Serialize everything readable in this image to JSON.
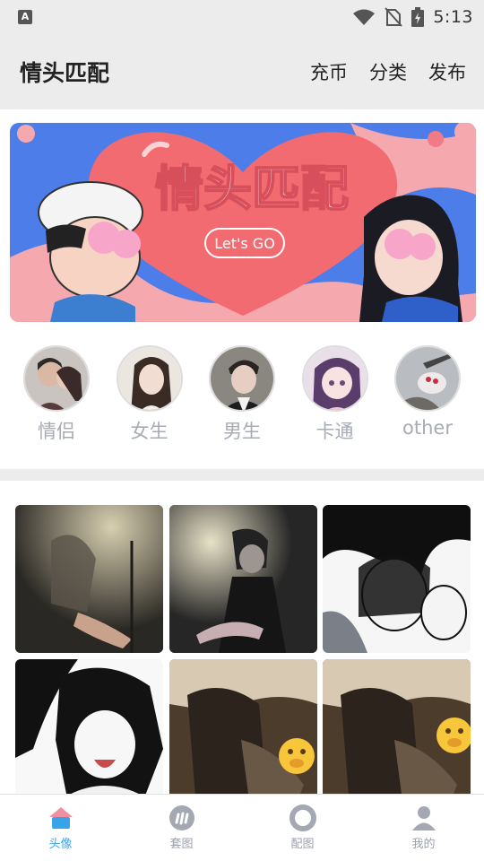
{
  "status_bar": {
    "left_icon": "A",
    "time": "5:13",
    "icons": [
      "wifi-icon",
      "no-sim-icon",
      "battery-icon"
    ]
  },
  "header": {
    "title": "情头匹配",
    "actions": [
      "充币",
      "分类",
      "发布"
    ]
  },
  "banner": {
    "title": "情头匹配",
    "badge": "Let's GO"
  },
  "categories": [
    {
      "label": "情侣"
    },
    {
      "label": "女生"
    },
    {
      "label": "男生"
    },
    {
      "label": "卡通"
    },
    {
      "label": "other"
    }
  ],
  "grid_tiles": [
    {
      "name": "night-hands-photo"
    },
    {
      "name": "street-lamp-boy-photo"
    },
    {
      "name": "anime-couple-photo"
    },
    {
      "name": "anime-girl-photo"
    },
    {
      "name": "couple-selfie-photo"
    },
    {
      "name": "couple-selfie-photo-2"
    }
  ],
  "bottom_nav": [
    {
      "label": "头像",
      "icon": "house-icon",
      "active": true
    },
    {
      "label": "套图",
      "icon": "grid-icon",
      "active": false
    },
    {
      "label": "配图",
      "icon": "ring-icon",
      "active": false
    },
    {
      "label": "我的",
      "icon": "user-icon",
      "active": false
    }
  ],
  "colors": {
    "accent": "#3aa3e8",
    "muted": "#9aa0ad",
    "header_bg": "#ececec"
  }
}
